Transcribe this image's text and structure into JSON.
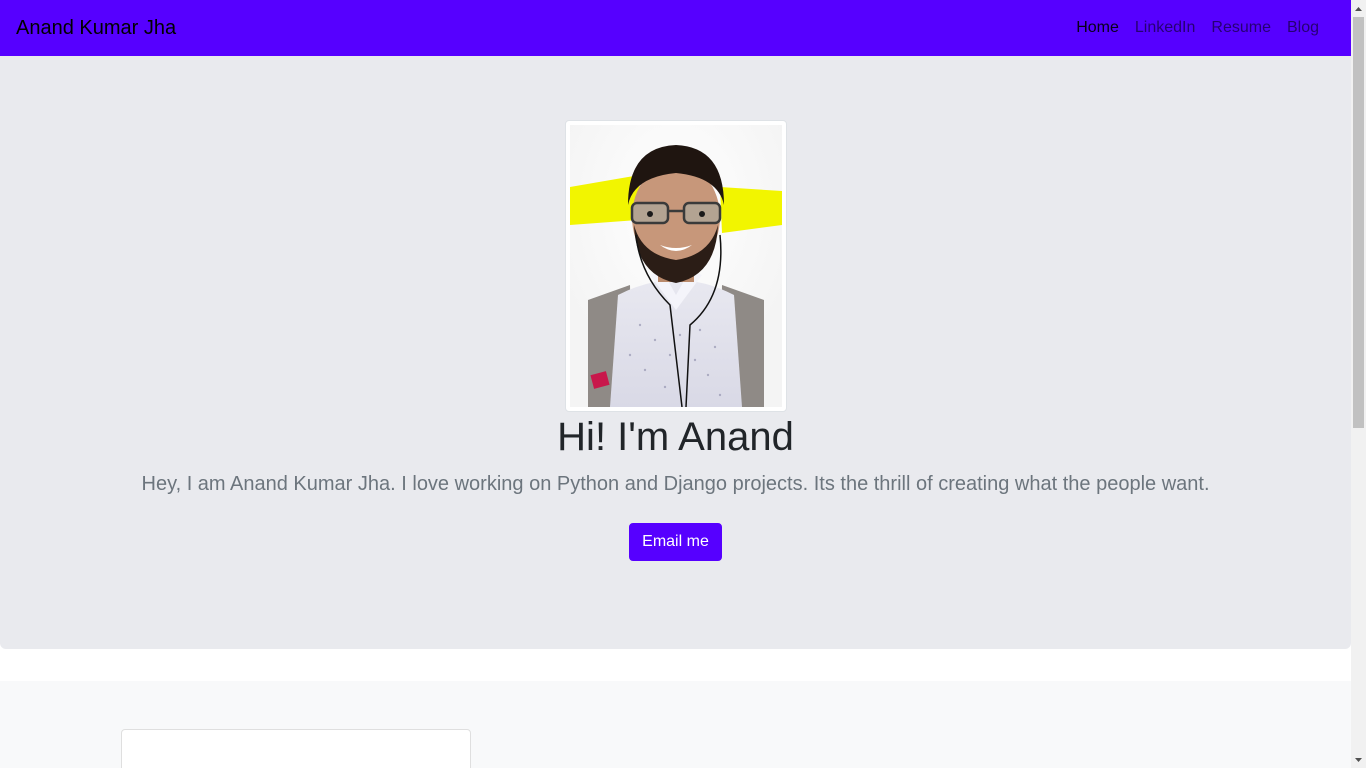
{
  "navbar": {
    "brand": "Anand Kumar Jha",
    "links": [
      {
        "label": "Home",
        "active": true
      },
      {
        "label": "LinkedIn",
        "active": false
      },
      {
        "label": "Resume",
        "active": false
      },
      {
        "label": "Blog",
        "active": false
      }
    ],
    "background_color": "#5600ff"
  },
  "hero": {
    "title": "Hi! I'm Anand",
    "lead": "Hey, I am Anand Kumar Jha. I love working on Python and Django projects. Its the thrill of creating what the people want.",
    "button_label": "Email me",
    "button_color": "#5600ff",
    "background_color": "#e9eaee"
  },
  "scrollbar": {
    "scroll_position": 0
  }
}
